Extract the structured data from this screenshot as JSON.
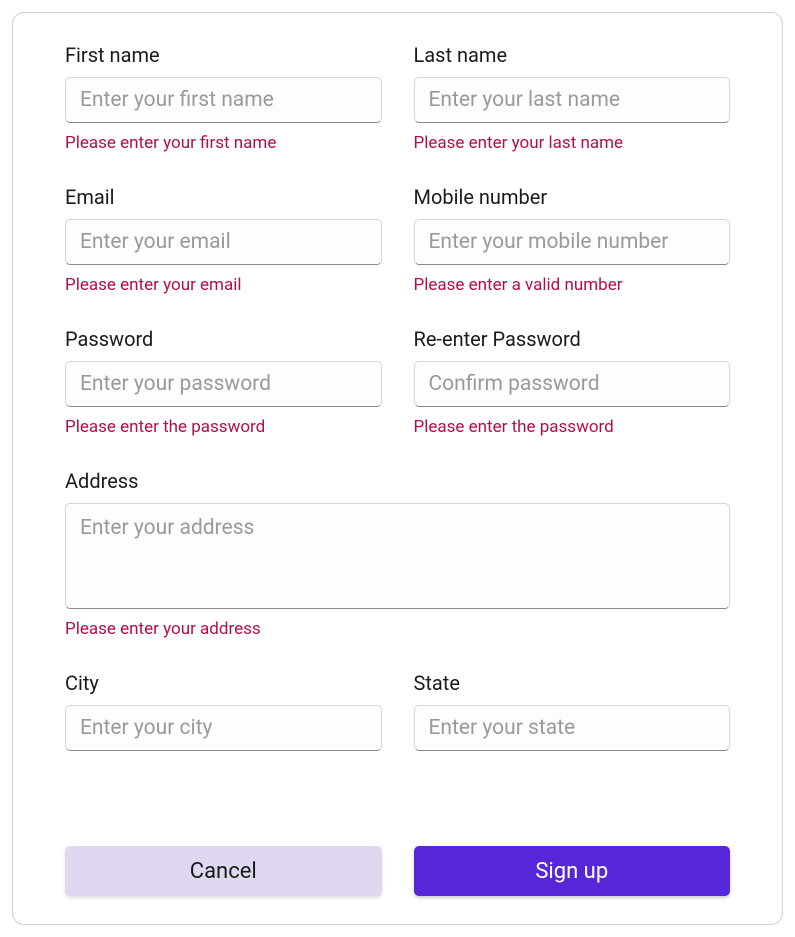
{
  "fields": {
    "first_name": {
      "label": "First name",
      "placeholder": "Enter your first name",
      "error": "Please enter your first name"
    },
    "last_name": {
      "label": "Last name",
      "placeholder": "Enter your last name",
      "error": "Please enter your last name"
    },
    "email": {
      "label": "Email",
      "placeholder": "Enter your email",
      "error": "Please enter your email"
    },
    "mobile": {
      "label": "Mobile number",
      "placeholder": "Enter your mobile number",
      "error": "Please enter a valid number"
    },
    "password": {
      "label": "Password",
      "placeholder": "Enter your password",
      "error": "Please enter the password"
    },
    "confirm_password": {
      "label": "Re-enter Password",
      "placeholder": "Confirm password",
      "error": "Please enter the password"
    },
    "address": {
      "label": "Address",
      "placeholder": "Enter your address",
      "error": "Please enter your address"
    },
    "city": {
      "label": "City",
      "placeholder": "Enter your city"
    },
    "state": {
      "label": "State",
      "placeholder": "Enter your state"
    }
  },
  "buttons": {
    "cancel": "Cancel",
    "signup": "Sign up"
  }
}
